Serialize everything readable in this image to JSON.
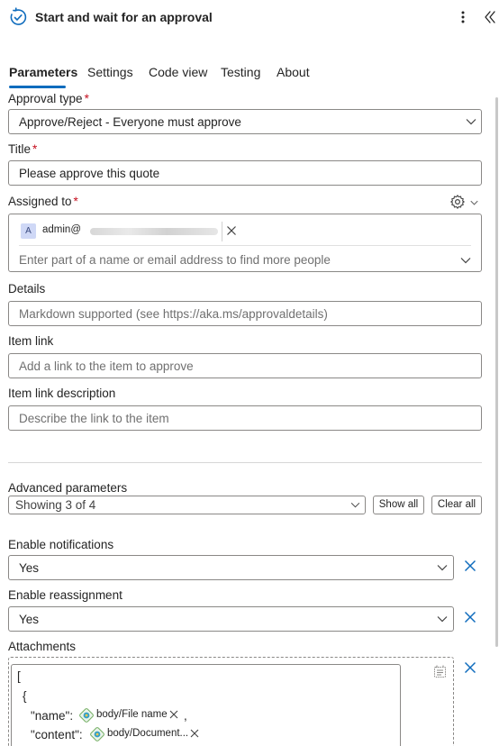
{
  "header": {
    "title": "Start and wait for an approval",
    "logo_icon": "approval-loop-icon",
    "accent": "#0f6cbd"
  },
  "tabs": [
    {
      "label": "Parameters",
      "active": true
    },
    {
      "label": "Settings"
    },
    {
      "label": "Code view"
    },
    {
      "label": "Testing"
    },
    {
      "label": "About"
    }
  ],
  "form": {
    "approval_type": {
      "label": "Approval type",
      "required": "*",
      "value": "Approve/Reject - Everyone must approve"
    },
    "title": {
      "label": "Title",
      "required": "*",
      "value": "Please approve this quote"
    },
    "assigned_to": {
      "label": "Assigned to",
      "required": "*",
      "chip_initial": "A",
      "chip_email": "admin@",
      "placeholder": "Enter part of a name or email address to find more people"
    },
    "details": {
      "label": "Details",
      "placeholder": "Markdown supported (see https://aka.ms/approvaldetails)"
    },
    "item_link": {
      "label": "Item link",
      "placeholder": "Add a link to the item to approve"
    },
    "item_link_description": {
      "label": "Item link description",
      "placeholder": "Describe the link to the item"
    }
  },
  "advanced": {
    "label": "Advanced parameters",
    "value": "Showing 3 of 4",
    "show_all": "Show all",
    "clear_all": "Clear all"
  },
  "enable_notifications": {
    "label": "Enable notifications",
    "value": "Yes"
  },
  "enable_reassignment": {
    "label": "Enable reassignment",
    "value": "Yes"
  },
  "attachments": {
    "label": "Attachments",
    "lines": {
      "open_bracket": "[",
      "open_brace": "{",
      "name_key": "\"name\":",
      "content_key": "\"content\":",
      "comma": ","
    },
    "tokens": {
      "file_name": "body/File name",
      "document": "body/Document..."
    }
  }
}
